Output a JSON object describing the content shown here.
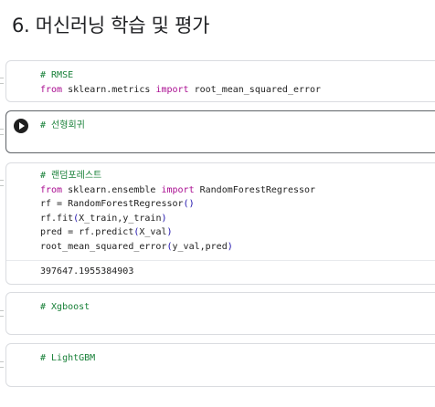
{
  "heading": "6. 머신러닝 학습 및 평가",
  "cells": [
    {
      "lines": [
        [
          [
            "cm",
            "# RMSE"
          ]
        ],
        [
          [
            "kw",
            "from"
          ],
          [
            "t",
            " sklearn.metrics "
          ],
          [
            "kw",
            "import"
          ],
          [
            "t",
            " root_mean_squared_error"
          ]
        ]
      ]
    },
    {
      "lines": [
        [
          [
            "cm",
            "# 선형회귀"
          ]
        ]
      ],
      "run_button": "run-cell"
    },
    {
      "lines": [
        [
          [
            "cm",
            "# 랜덤포레스트"
          ]
        ],
        [
          [
            "kw",
            "from"
          ],
          [
            "t",
            " sklearn.ensemble "
          ],
          [
            "kw",
            "import"
          ],
          [
            "t",
            " RandomForestRegressor"
          ]
        ],
        [
          [
            "t",
            "rf = RandomForestRegressor"
          ],
          [
            "p",
            "()"
          ]
        ],
        [
          [
            "t",
            "rf.fit"
          ],
          [
            "p",
            "("
          ],
          [
            "t",
            "X_train,y_train"
          ],
          [
            "p",
            ")"
          ]
        ],
        [
          [
            "t",
            "pred = rf.predict"
          ],
          [
            "p",
            "("
          ],
          [
            "t",
            "X_val"
          ],
          [
            "p",
            ")"
          ]
        ],
        [
          [
            "t",
            "root_mean_squared_error"
          ],
          [
            "p",
            "("
          ],
          [
            "t",
            "y_val,pred"
          ],
          [
            "p",
            ")"
          ]
        ]
      ],
      "output": "397647.1955384903"
    },
    {
      "lines": [
        [
          [
            "cm",
            "# Xgboost"
          ]
        ]
      ]
    },
    {
      "lines": [
        [
          [
            "cm",
            "# LightGBM"
          ]
        ]
      ]
    }
  ]
}
